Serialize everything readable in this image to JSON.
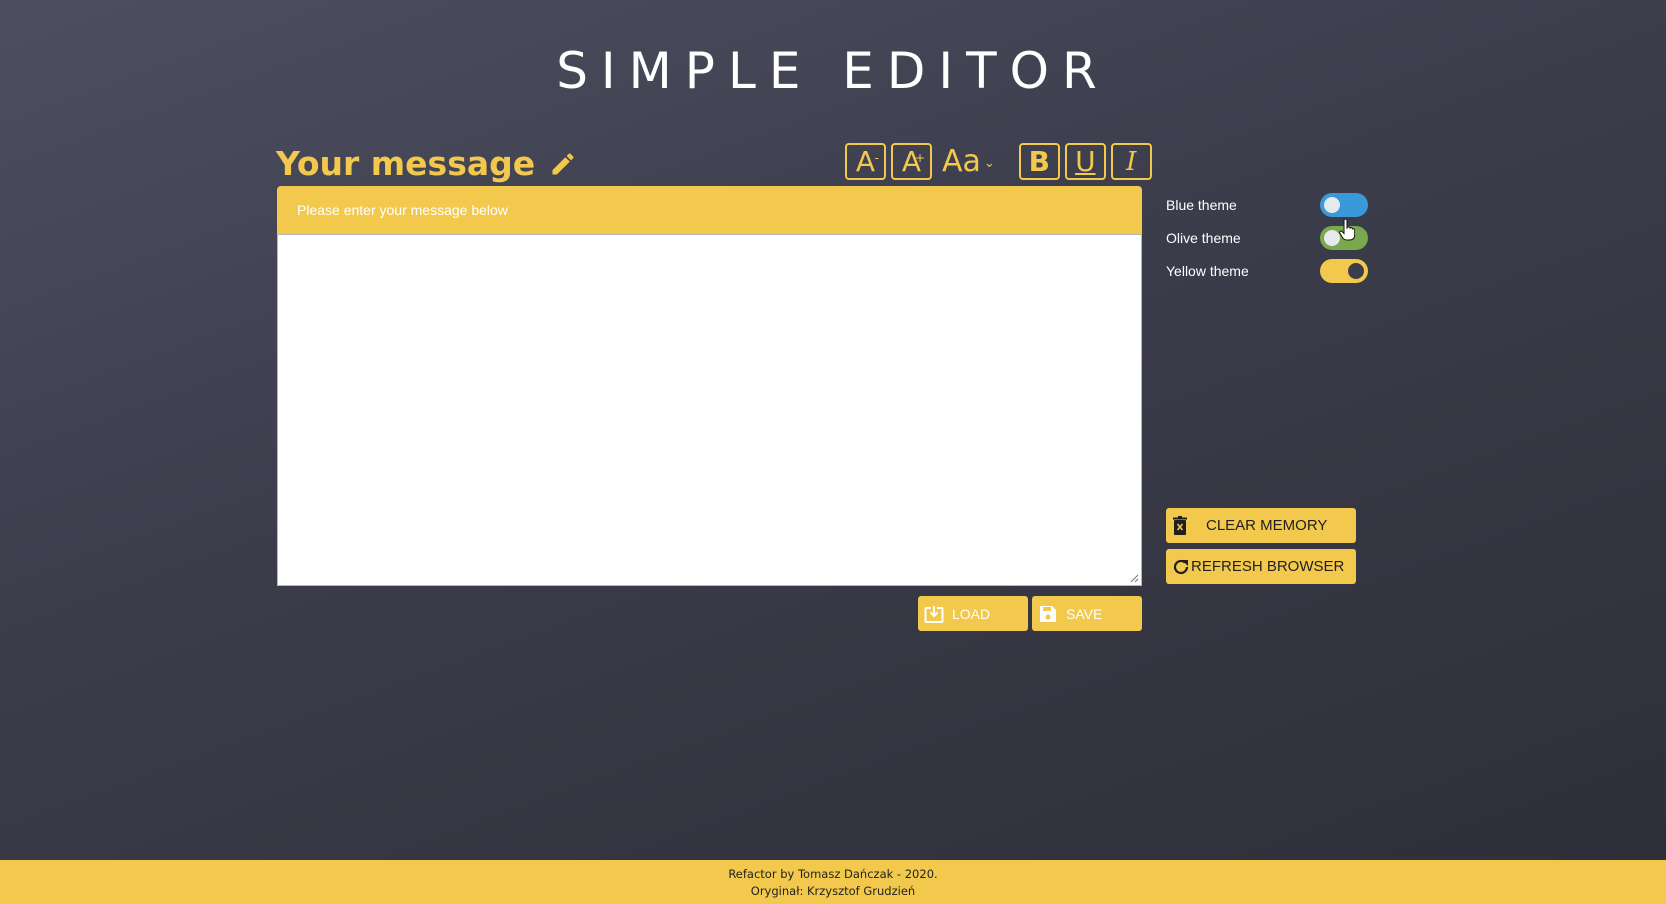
{
  "app": {
    "title": "SIMPLE EDITOR"
  },
  "editor": {
    "heading": "Your message",
    "placeholder": "Please enter your message below",
    "content": ""
  },
  "toolbar": {
    "decrease_label": "A",
    "decrease_mark": "-",
    "increase_label": "A",
    "increase_mark": "+",
    "font_label": "Aa",
    "font_chevron": "⌄",
    "bold_label": "B",
    "underline_label": "U",
    "italic_label": "I"
  },
  "themes": [
    {
      "label": "Blue theme",
      "on": false,
      "color": "#3a9ad9"
    },
    {
      "label": "Olive theme",
      "on": false,
      "color": "#79a84d"
    },
    {
      "label": "Yellow theme",
      "on": true,
      "color": "#f2c94c"
    }
  ],
  "actions": {
    "clear_label": "CLEAR MEMORY",
    "refresh_label": "REFRESH BROWSER",
    "load_label": "LOAD",
    "save_label": "SAVE"
  },
  "footer": {
    "line1": "Refactor by Tomasz Dańczak - 2020.",
    "line2": "Oryginał: Krzysztof Grudzień"
  },
  "colors": {
    "accent": "#f2c94c",
    "background": "#3b3c4a"
  },
  "icons": {
    "edit": "pencil-icon",
    "clear": "trash-icon",
    "refresh": "refresh-icon",
    "load": "download-icon",
    "save": "floppy-disk-icon"
  }
}
